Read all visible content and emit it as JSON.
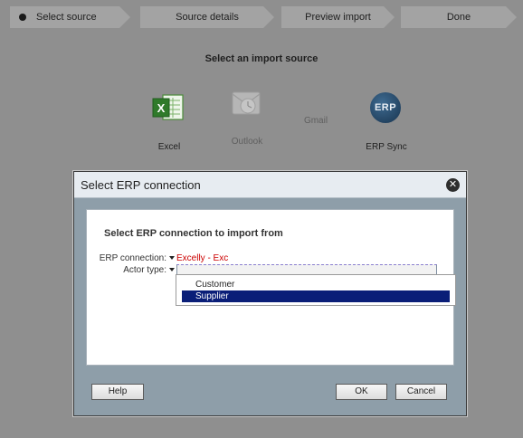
{
  "wizard": {
    "steps": [
      {
        "label": "Select source",
        "active": true
      },
      {
        "label": "Source details",
        "active": false
      },
      {
        "label": "Preview import",
        "active": false
      },
      {
        "label": "Done",
        "active": false
      }
    ],
    "heading": "Select an import source",
    "sources": [
      {
        "label": "Excel",
        "icon": "excel-icon",
        "enabled": true
      },
      {
        "label": "Outlook",
        "icon": "outlook-icon",
        "enabled": false
      },
      {
        "label": "Gmail",
        "icon": "gmail-icon",
        "enabled": false
      },
      {
        "label": "ERP Sync",
        "icon": "erp-icon",
        "icon_text": "ERP",
        "enabled": true
      }
    ]
  },
  "dialog": {
    "title": "Select ERP connection",
    "close_icon": "close-icon",
    "heading": "Select ERP connection to import from",
    "erp_connection": {
      "label": "ERP connection:",
      "value": "Excelly - Exc"
    },
    "actor_type": {
      "label": "Actor type:",
      "value": "",
      "options": [
        "Customer",
        "Supplier"
      ],
      "highlighted": "Supplier"
    },
    "buttons": {
      "help": "Help",
      "ok": "OK",
      "cancel": "Cancel"
    }
  },
  "colors": {
    "overlay": "#8f8f8f",
    "step_bg": "#a3a3a3",
    "dialog_frame": "#8e9ea9",
    "titlebar": "#e7ecf1",
    "error_text": "#cc0000",
    "selection": "#0a1e78"
  }
}
